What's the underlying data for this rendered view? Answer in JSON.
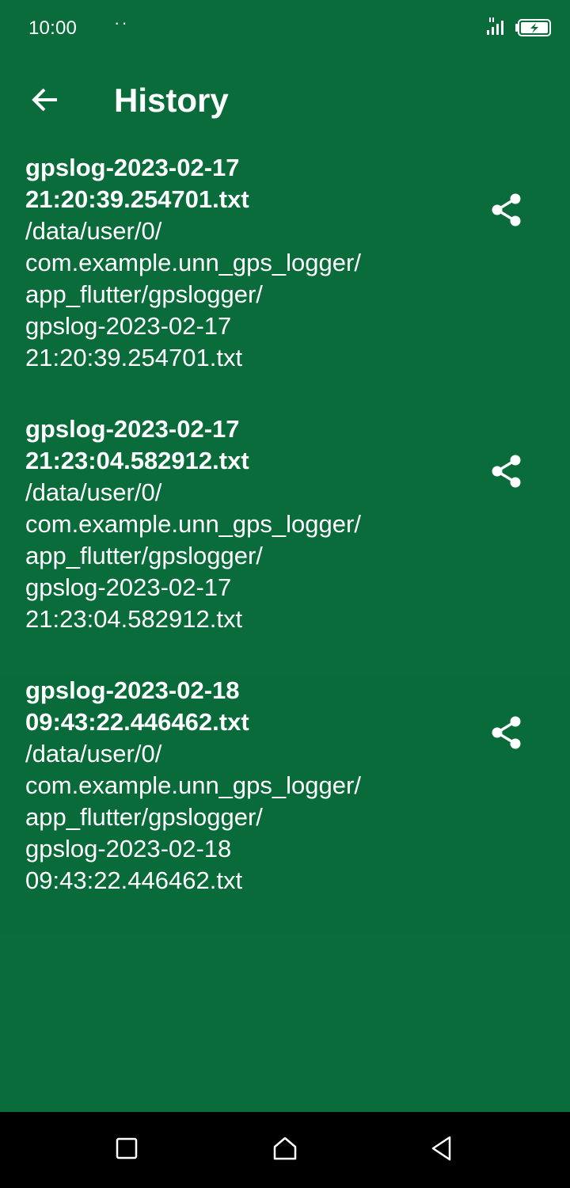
{
  "status_bar": {
    "time": "10:00",
    "indicator": "··",
    "signal_icon": "signal-icon",
    "battery_icon": "battery-charging-icon"
  },
  "app_bar": {
    "title": "History",
    "back_icon": "arrow-back-icon"
  },
  "history": {
    "items": [
      {
        "name": "gpslog-2023-02-17\n21:20:39.254701.txt",
        "path": "/data/user/0/\ncom.example.unn_gps_logger/\napp_flutter/gpslogger/\ngpslog-2023-02-17\n21:20:39.254701.txt"
      },
      {
        "name": "gpslog-2023-02-17\n21:23:04.582912.txt",
        "path": "/data/user/0/\ncom.example.unn_gps_logger/\napp_flutter/gpslogger/\ngpslog-2023-02-17\n21:23:04.582912.txt"
      },
      {
        "name": "gpslog-2023-02-18\n09:43:22.446462.txt",
        "path": "/data/user/0/\ncom.example.unn_gps_logger/\napp_flutter/gpslogger/\ngpslog-2023-02-18\n09:43:22.446462.txt"
      }
    ],
    "share_icon": "share-icon"
  },
  "nav_bar": {
    "recents_icon": "square-icon",
    "home_icon": "home-icon",
    "back_icon": "triangle-back-icon"
  },
  "colors": {
    "background": "#0a6b3b",
    "nav_background": "#000000",
    "text": "#ffffff"
  }
}
